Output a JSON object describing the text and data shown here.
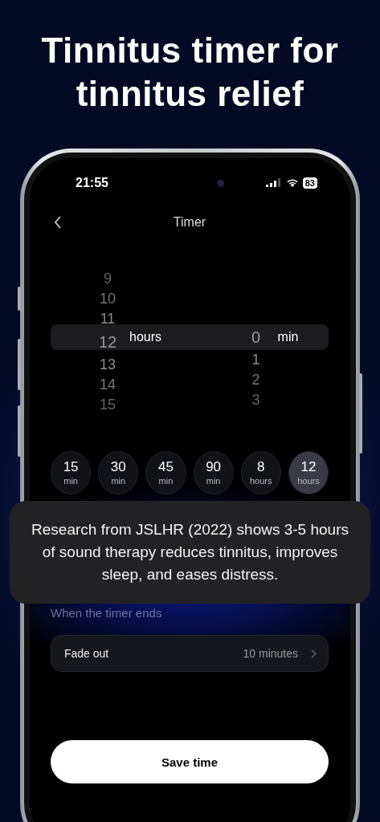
{
  "headline": "Tinnitus timer for tinnitus relief",
  "status_bar": {
    "time": "21:55",
    "battery": "83"
  },
  "nav": {
    "title": "Timer"
  },
  "picker": {
    "columns": [
      {
        "unit": "hours",
        "items": [
          {
            "value": "9",
            "selected": false
          },
          {
            "value": "10",
            "selected": false
          },
          {
            "value": "11",
            "selected": false
          },
          {
            "value": "12",
            "selected": true
          },
          {
            "value": "13",
            "selected": false
          },
          {
            "value": "14",
            "selected": false
          },
          {
            "value": "15",
            "selected": false
          }
        ]
      },
      {
        "unit": "min",
        "items": [
          {
            "value": "0",
            "selected": true
          },
          {
            "value": "1",
            "selected": false
          },
          {
            "value": "2",
            "selected": false
          },
          {
            "value": "3",
            "selected": false
          }
        ]
      }
    ]
  },
  "presets": [
    {
      "value": "15",
      "unit": "min",
      "selected": false
    },
    {
      "value": "30",
      "unit": "min",
      "selected": false
    },
    {
      "value": "45",
      "unit": "min",
      "selected": false
    },
    {
      "value": "90",
      "unit": "min",
      "selected": false
    },
    {
      "value": "8",
      "unit": "hours",
      "selected": false
    },
    {
      "value": "12",
      "unit": "hours",
      "selected": true
    }
  ],
  "section_label": "When the timer ends",
  "fade_row": {
    "label": "Fade out",
    "value": "10 minutes"
  },
  "save_button": "Save time",
  "info_card": "Research from JSLHR (2022) shows 3-5 hours of sound therapy reduces tinnitus, improves sleep, and eases distress."
}
